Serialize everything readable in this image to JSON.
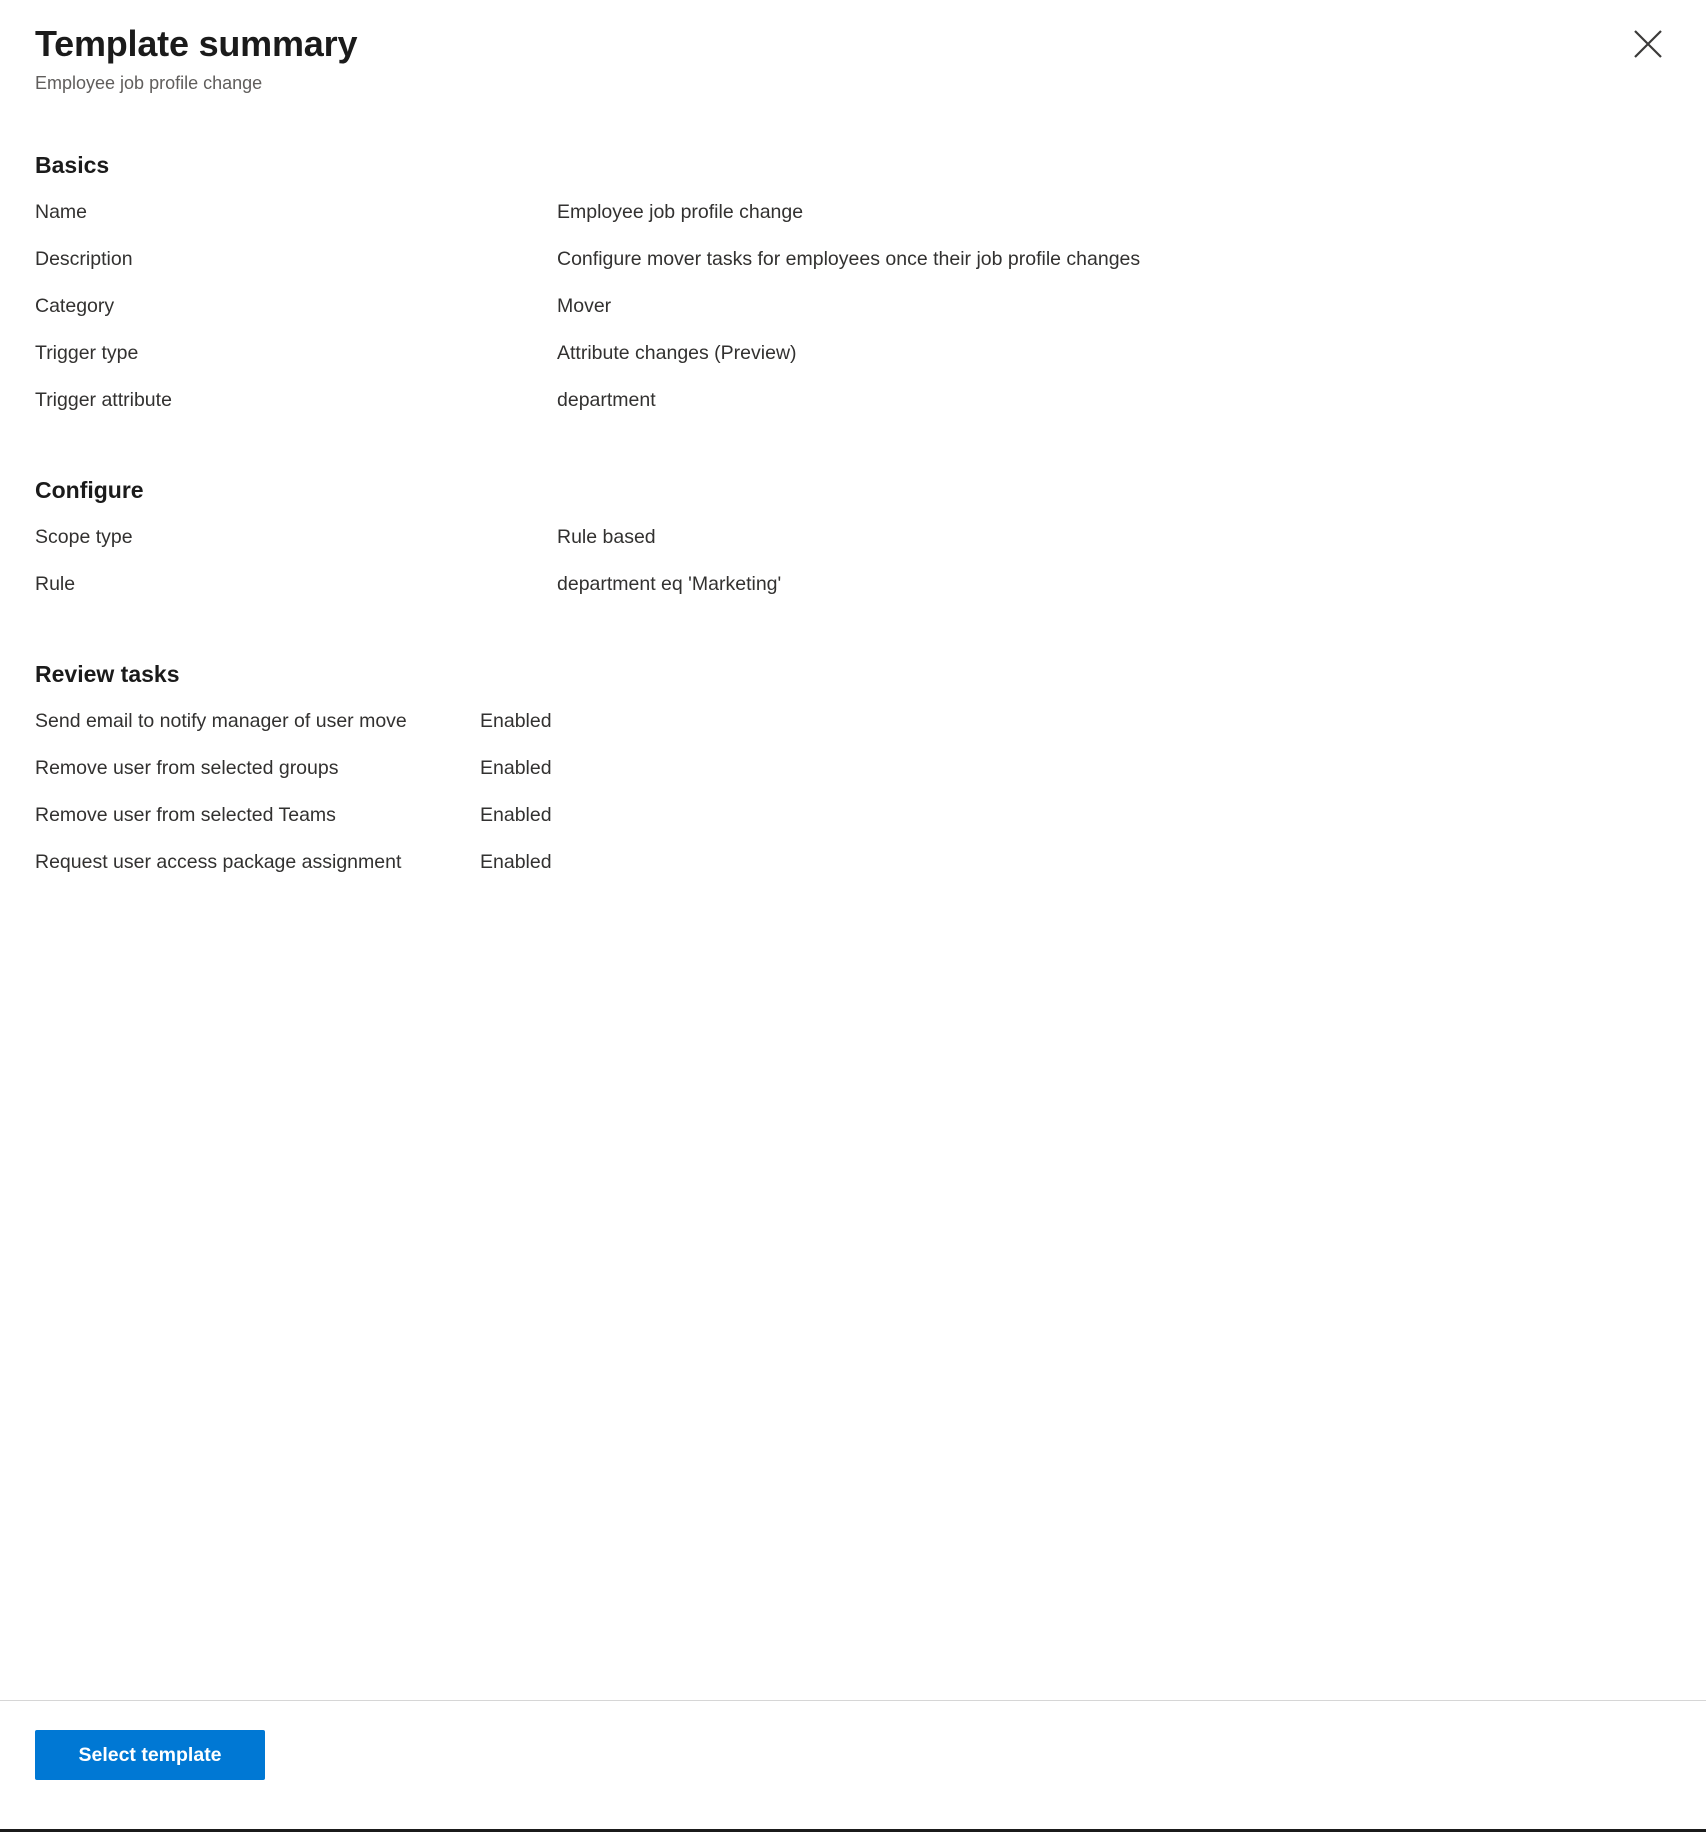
{
  "header": {
    "title": "Template summary",
    "subtitle": "Employee job profile change",
    "close_icon": "close-icon",
    "close_label": "Close"
  },
  "sections": [
    {
      "id": "basics",
      "heading": "Basics",
      "rows": [
        {
          "label": "Name",
          "value": "Employee job profile change"
        },
        {
          "label": "Description",
          "value": "Configure mover tasks for employees once their job profile changes"
        },
        {
          "label": "Category",
          "value": "Mover"
        },
        {
          "label": "Trigger type",
          "value": "Attribute changes (Preview)"
        },
        {
          "label": "Trigger attribute",
          "value": "department"
        }
      ]
    },
    {
      "id": "configure",
      "heading": "Configure",
      "rows": [
        {
          "label": "Scope type",
          "value": "Rule based"
        },
        {
          "label": "Rule",
          "value": "department eq 'Marketing'"
        }
      ]
    },
    {
      "id": "review-tasks",
      "heading": "Review tasks",
      "rows": [
        {
          "label": "Send email to notify manager of user move",
          "value": "Enabled"
        },
        {
          "label": "Remove user from selected groups",
          "value": "Enabled"
        },
        {
          "label": "Remove user from selected Teams",
          "value": "Enabled"
        },
        {
          "label": "Request user access package assignment",
          "value": "Enabled"
        }
      ]
    }
  ],
  "footer": {
    "select_template_label": "Select template"
  },
  "colors": {
    "accent": "#0078d4",
    "text": "#323130",
    "heading": "#1b1b1b",
    "subtitle": "#605e5c",
    "divider": "#d6d6d6"
  }
}
